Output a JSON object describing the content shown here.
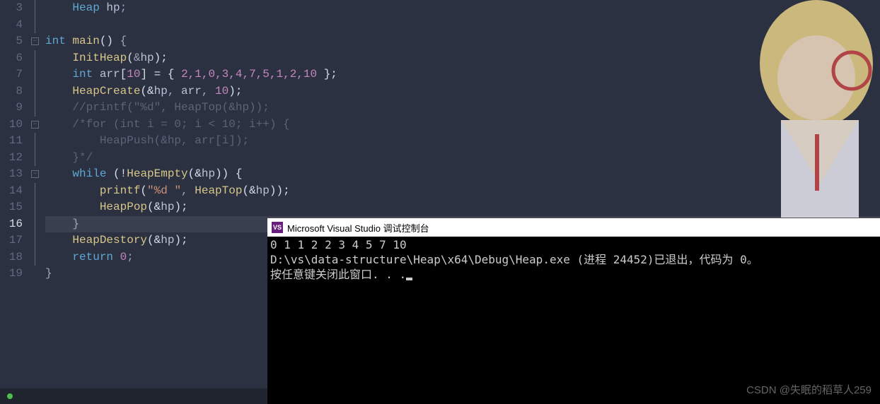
{
  "gutter": {
    "lines": [
      "3",
      "4",
      "5",
      "6",
      "7",
      "8",
      "9",
      "10",
      "11",
      "12",
      "13",
      "14",
      "15",
      "16",
      "17",
      "18",
      "19"
    ],
    "current_index": 13
  },
  "fold": {
    "markers": {
      "2": "⊟",
      "7": "⊟",
      "10": "⊟"
    }
  },
  "code": {
    "l3": {
      "heap": "Heap",
      "hp": "hp",
      "semi": ";"
    },
    "l5": {
      "kw": "int",
      "fn": "main",
      "par": "()",
      "br": " {"
    },
    "l6": {
      "fn": "InitHeap",
      "amp": "&",
      "hp": "hp",
      "close": ");"
    },
    "l7": {
      "kw": "int",
      "arr": "arr",
      "lb": "[",
      "sz": "10",
      "rb": "] = { ",
      "v": "2,1,0,3,4,7,5,1,2,10",
      "end": " };"
    },
    "l8": {
      "fn": "HeapCreate",
      "open": "(&",
      "hp": "hp",
      "c1": ", ",
      "arr": "arr",
      "c2": ", ",
      "n": "10",
      "end": ");"
    },
    "l9": {
      "cm": "//printf(\"%d\", HeapTop(&hp));"
    },
    "l10": {
      "cm": "/*for (int i = 0; i < 10; i++) {"
    },
    "l11": {
      "cm": "    HeapPush(&hp, arr[i]);"
    },
    "l12": {
      "cm": "}*/"
    },
    "l13": {
      "kw": "while",
      "open": " (!",
      "fn": "HeapEmpty",
      "p": "(&",
      "hp": "hp",
      "cl": ")) {"
    },
    "l14": {
      "fn": "printf",
      "open": "(",
      "str": "\"%d \"",
      "c": ", ",
      "fn2": "HeapTop",
      "p": "(&",
      "hp": "hp",
      "end": "));"
    },
    "l15": {
      "fn": "HeapPop",
      "p": "(&",
      "hp": "hp",
      "end": ");"
    },
    "l16": {
      "br": "}"
    },
    "l17": {
      "fn": "HeapDestory",
      "p": "(&",
      "hp": "hp",
      "end": ");"
    },
    "l18": {
      "kw": "return",
      "sp": " ",
      "n": "0",
      "end": ";"
    },
    "l19": {
      "br": "}"
    }
  },
  "console": {
    "icon": "⧉",
    "title": "Microsoft Visual Studio 调试控制台",
    "line1": "0 1 1 2 2 3 4 5 7 10",
    "line2": "D:\\vs\\data-structure\\Heap\\x64\\Debug\\Heap.exe (进程 24452)已退出，代码为 0。",
    "line3": "按任意键关闭此窗口. . ."
  },
  "watermark": "CSDN @失眠的稻草人259",
  "status": {
    "text": ""
  }
}
